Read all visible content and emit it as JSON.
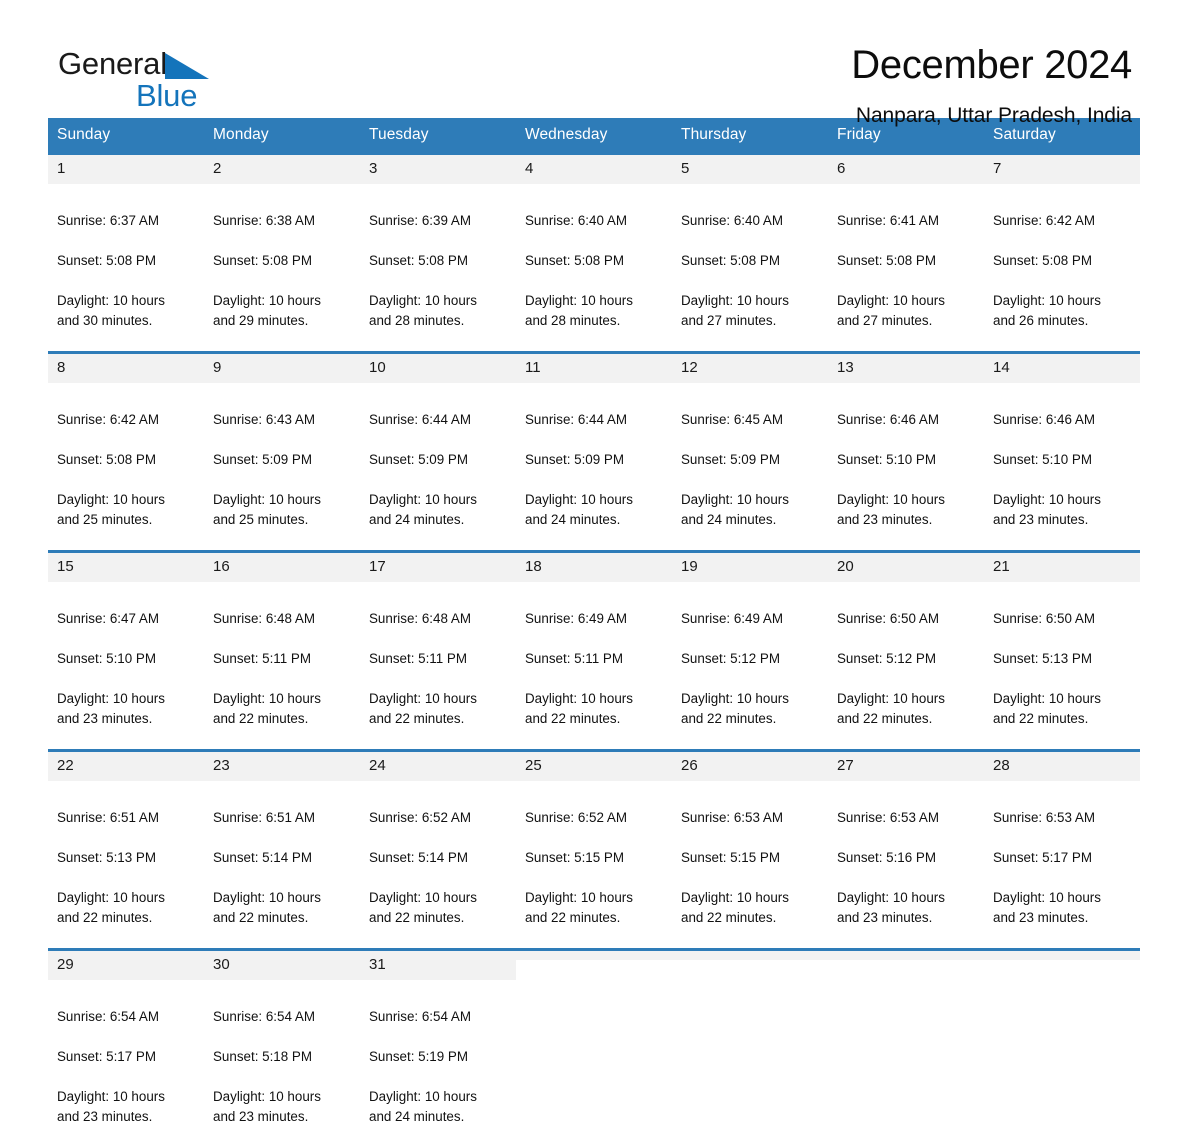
{
  "brand": {
    "name_part1": "General",
    "name_part2": "Blue",
    "triangle_color": "#1474bb"
  },
  "header": {
    "title": "December 2024",
    "location": "Nanpara, Uttar Pradesh, India"
  },
  "calendar": {
    "header_color": "#2e7cb8",
    "weekdays": [
      "Sunday",
      "Monday",
      "Tuesday",
      "Wednesday",
      "Thursday",
      "Friday",
      "Saturday"
    ],
    "weeks": [
      [
        {
          "day": "1",
          "sunrise": "Sunrise: 6:37 AM",
          "sunset": "Sunset: 5:08 PM",
          "daylight": "Daylight: 10 hours\nand 30 minutes."
        },
        {
          "day": "2",
          "sunrise": "Sunrise: 6:38 AM",
          "sunset": "Sunset: 5:08 PM",
          "daylight": "Daylight: 10 hours\nand 29 minutes."
        },
        {
          "day": "3",
          "sunrise": "Sunrise: 6:39 AM",
          "sunset": "Sunset: 5:08 PM",
          "daylight": "Daylight: 10 hours\nand 28 minutes."
        },
        {
          "day": "4",
          "sunrise": "Sunrise: 6:40 AM",
          "sunset": "Sunset: 5:08 PM",
          "daylight": "Daylight: 10 hours\nand 28 minutes."
        },
        {
          "day": "5",
          "sunrise": "Sunrise: 6:40 AM",
          "sunset": "Sunset: 5:08 PM",
          "daylight": "Daylight: 10 hours\nand 27 minutes."
        },
        {
          "day": "6",
          "sunrise": "Sunrise: 6:41 AM",
          "sunset": "Sunset: 5:08 PM",
          "daylight": "Daylight: 10 hours\nand 27 minutes."
        },
        {
          "day": "7",
          "sunrise": "Sunrise: 6:42 AM",
          "sunset": "Sunset: 5:08 PM",
          "daylight": "Daylight: 10 hours\nand 26 minutes."
        }
      ],
      [
        {
          "day": "8",
          "sunrise": "Sunrise: 6:42 AM",
          "sunset": "Sunset: 5:08 PM",
          "daylight": "Daylight: 10 hours\nand 25 minutes."
        },
        {
          "day": "9",
          "sunrise": "Sunrise: 6:43 AM",
          "sunset": "Sunset: 5:09 PM",
          "daylight": "Daylight: 10 hours\nand 25 minutes."
        },
        {
          "day": "10",
          "sunrise": "Sunrise: 6:44 AM",
          "sunset": "Sunset: 5:09 PM",
          "daylight": "Daylight: 10 hours\nand 24 minutes."
        },
        {
          "day": "11",
          "sunrise": "Sunrise: 6:44 AM",
          "sunset": "Sunset: 5:09 PM",
          "daylight": "Daylight: 10 hours\nand 24 minutes."
        },
        {
          "day": "12",
          "sunrise": "Sunrise: 6:45 AM",
          "sunset": "Sunset: 5:09 PM",
          "daylight": "Daylight: 10 hours\nand 24 minutes."
        },
        {
          "day": "13",
          "sunrise": "Sunrise: 6:46 AM",
          "sunset": "Sunset: 5:10 PM",
          "daylight": "Daylight: 10 hours\nand 23 minutes."
        },
        {
          "day": "14",
          "sunrise": "Sunrise: 6:46 AM",
          "sunset": "Sunset: 5:10 PM",
          "daylight": "Daylight: 10 hours\nand 23 minutes."
        }
      ],
      [
        {
          "day": "15",
          "sunrise": "Sunrise: 6:47 AM",
          "sunset": "Sunset: 5:10 PM",
          "daylight": "Daylight: 10 hours\nand 23 minutes."
        },
        {
          "day": "16",
          "sunrise": "Sunrise: 6:48 AM",
          "sunset": "Sunset: 5:11 PM",
          "daylight": "Daylight: 10 hours\nand 22 minutes."
        },
        {
          "day": "17",
          "sunrise": "Sunrise: 6:48 AM",
          "sunset": "Sunset: 5:11 PM",
          "daylight": "Daylight: 10 hours\nand 22 minutes."
        },
        {
          "day": "18",
          "sunrise": "Sunrise: 6:49 AM",
          "sunset": "Sunset: 5:11 PM",
          "daylight": "Daylight: 10 hours\nand 22 minutes."
        },
        {
          "day": "19",
          "sunrise": "Sunrise: 6:49 AM",
          "sunset": "Sunset: 5:12 PM",
          "daylight": "Daylight: 10 hours\nand 22 minutes."
        },
        {
          "day": "20",
          "sunrise": "Sunrise: 6:50 AM",
          "sunset": "Sunset: 5:12 PM",
          "daylight": "Daylight: 10 hours\nand 22 minutes."
        },
        {
          "day": "21",
          "sunrise": "Sunrise: 6:50 AM",
          "sunset": "Sunset: 5:13 PM",
          "daylight": "Daylight: 10 hours\nand 22 minutes."
        }
      ],
      [
        {
          "day": "22",
          "sunrise": "Sunrise: 6:51 AM",
          "sunset": "Sunset: 5:13 PM",
          "daylight": "Daylight: 10 hours\nand 22 minutes."
        },
        {
          "day": "23",
          "sunrise": "Sunrise: 6:51 AM",
          "sunset": "Sunset: 5:14 PM",
          "daylight": "Daylight: 10 hours\nand 22 minutes."
        },
        {
          "day": "24",
          "sunrise": "Sunrise: 6:52 AM",
          "sunset": "Sunset: 5:14 PM",
          "daylight": "Daylight: 10 hours\nand 22 minutes."
        },
        {
          "day": "25",
          "sunrise": "Sunrise: 6:52 AM",
          "sunset": "Sunset: 5:15 PM",
          "daylight": "Daylight: 10 hours\nand 22 minutes."
        },
        {
          "day": "26",
          "sunrise": "Sunrise: 6:53 AM",
          "sunset": "Sunset: 5:15 PM",
          "daylight": "Daylight: 10 hours\nand 22 minutes."
        },
        {
          "day": "27",
          "sunrise": "Sunrise: 6:53 AM",
          "sunset": "Sunset: 5:16 PM",
          "daylight": "Daylight: 10 hours\nand 23 minutes."
        },
        {
          "day": "28",
          "sunrise": "Sunrise: 6:53 AM",
          "sunset": "Sunset: 5:17 PM",
          "daylight": "Daylight: 10 hours\nand 23 minutes."
        }
      ],
      [
        {
          "day": "29",
          "sunrise": "Sunrise: 6:54 AM",
          "sunset": "Sunset: 5:17 PM",
          "daylight": "Daylight: 10 hours\nand 23 minutes."
        },
        {
          "day": "30",
          "sunrise": "Sunrise: 6:54 AM",
          "sunset": "Sunset: 5:18 PM",
          "daylight": "Daylight: 10 hours\nand 23 minutes."
        },
        {
          "day": "31",
          "sunrise": "Sunrise: 6:54 AM",
          "sunset": "Sunset: 5:19 PM",
          "daylight": "Daylight: 10 hours\nand 24 minutes."
        },
        {
          "day": "",
          "sunrise": "",
          "sunset": "",
          "daylight": ""
        },
        {
          "day": "",
          "sunrise": "",
          "sunset": "",
          "daylight": ""
        },
        {
          "day": "",
          "sunrise": "",
          "sunset": "",
          "daylight": ""
        },
        {
          "day": "",
          "sunrise": "",
          "sunset": "",
          "daylight": ""
        }
      ]
    ]
  }
}
